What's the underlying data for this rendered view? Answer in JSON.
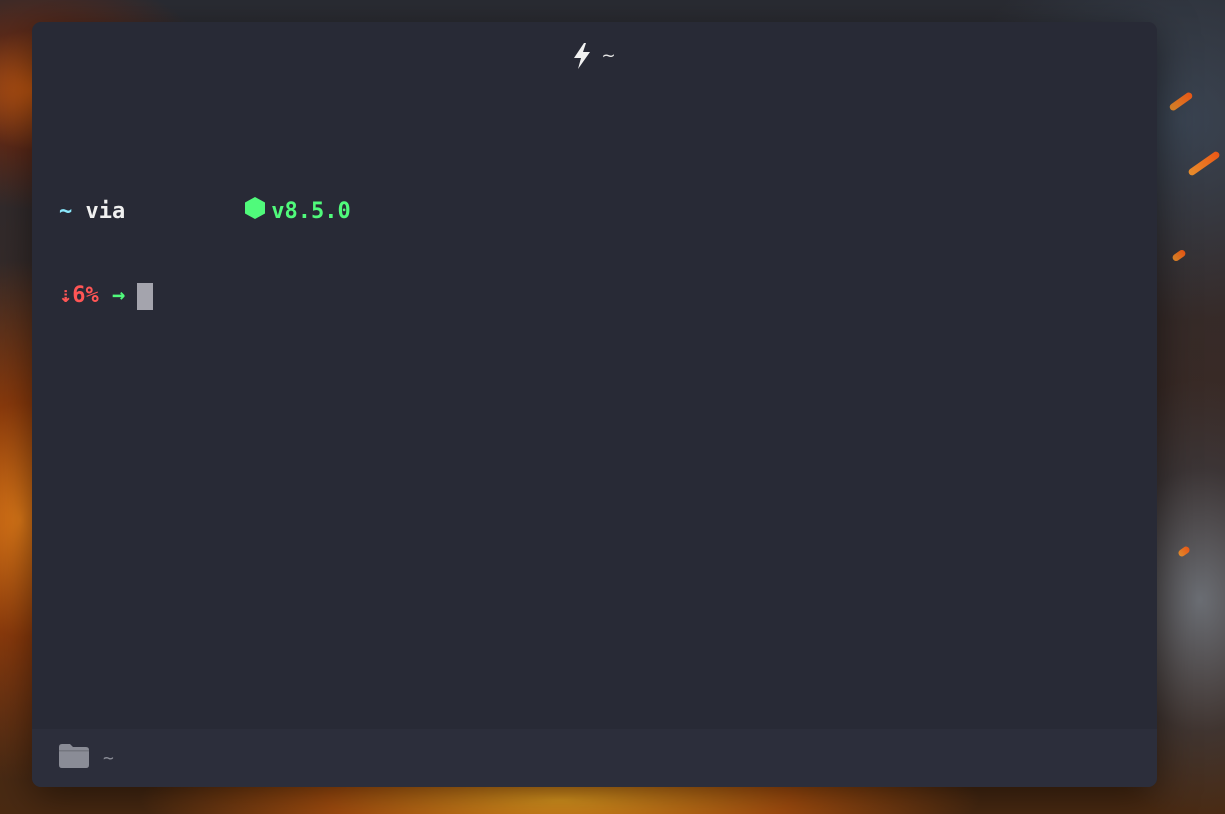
{
  "window": {
    "title_icon": "lightning-bolt-icon",
    "title": "~"
  },
  "prompt": {
    "dir": "~",
    "via": "via",
    "node_icon": "node-hexagon-icon",
    "node_version": "v8.5.0",
    "battery": "⇣6%",
    "arrow": "→"
  },
  "statusbar": {
    "folder_icon": "folder-icon",
    "cwd": "~"
  },
  "colors": {
    "terminal_bg": "#282a36",
    "statusbar_bg": "#2c2e3b",
    "dir": "#8be9fd",
    "node": "#50fa7b",
    "battery": "#ff5555",
    "cursor": "#a4a4ad"
  }
}
